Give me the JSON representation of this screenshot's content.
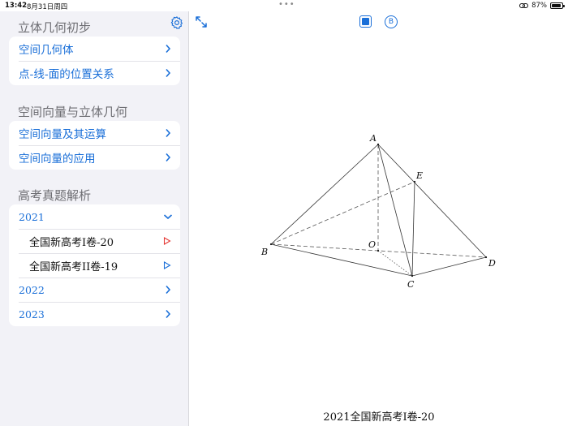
{
  "status_bar": {
    "time": "13:42",
    "date": "8月31日周四",
    "battery": "87%",
    "battery_level": 0.87
  },
  "sidebar": {
    "sections": [
      {
        "title": "立体几何初步",
        "items": [
          {
            "label": "空间几何体"
          },
          {
            "label": "点-线-面的位置关系"
          }
        ]
      },
      {
        "title": "空间向量与立体几何",
        "items": [
          {
            "label": "空间向量及其运算"
          },
          {
            "label": "空间向量的应用"
          }
        ]
      },
      {
        "title": "高考真题解析",
        "years": [
          {
            "label": "2021"
          },
          {
            "label": "2022"
          },
          {
            "label": "2023"
          }
        ],
        "problems": [
          {
            "label": "全国新高考I卷-20"
          },
          {
            "label": "全国新高考II卷-19"
          }
        ]
      }
    ]
  },
  "main": {
    "caption": "2021全国新高考I卷-20",
    "points": {
      "A": "A",
      "B": "B",
      "C": "C",
      "D": "D",
      "E": "E",
      "O": "O"
    },
    "colors": {
      "accent": "#1a6fd8",
      "active_marker": "#e53935"
    }
  }
}
